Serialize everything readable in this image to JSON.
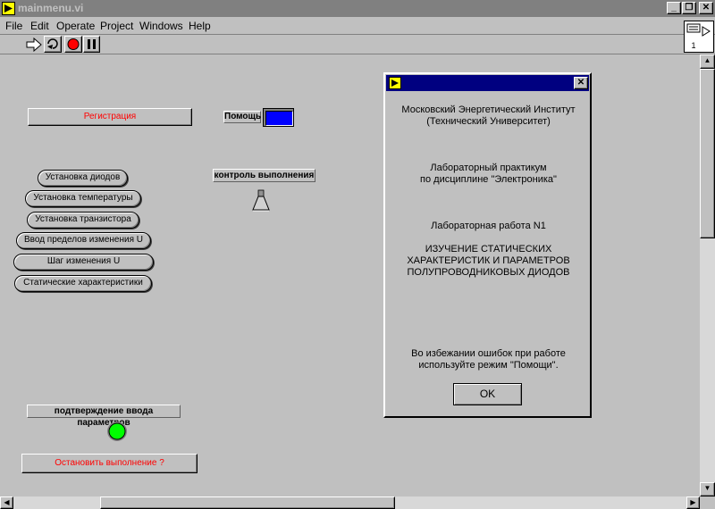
{
  "window": {
    "title": "mainmenu.vi",
    "page_number": "1"
  },
  "menu": [
    "File",
    "Edit",
    "Operate",
    "Project",
    "Windows",
    "Help"
  ],
  "toolbar": {
    "run_icon": "run-arrow-icon",
    "continuous_icon": "continuous-run-icon",
    "abort_icon": "abort-icon",
    "pause_icon": "pause-icon"
  },
  "panel": {
    "registration_button": "Регистрация",
    "help_label": "Помощь",
    "help_indicator_color": "#0000ff",
    "buttons": [
      "Установка диодов",
      "Установка температуры",
      "Установка транзистора",
      "Ввод пределов изменения U",
      "Шаг изменения U",
      "Статические характеристики"
    ],
    "execution_control_label": "контроль выполнения",
    "confirm_label": "подтверждение ввода параметров",
    "confirm_led_color": "#00ff00",
    "stop_button": "Остановить выполнение ?"
  },
  "dialog": {
    "institute_line1": "Московский Энергетический Институт",
    "institute_line2": "(Технический Университет)",
    "practicum_line1": "Лабораторный практикум",
    "practicum_line2": "по дисциплине \"Электроника\"",
    "lab_number": "Лабораторная работа N1",
    "topic_line1": "ИЗУЧЕНИЕ СТАТИЧЕСКИХ",
    "topic_line2": "ХАРАКТЕРИСТИК И ПАРАМЕТРОВ",
    "topic_line3": "ПОЛУПРОВОДНИКОВЫХ ДИОДОВ",
    "hint_line1": "Во избежании ошибок при работе",
    "hint_line2": "используйте режим \"Помощи\".",
    "ok_button": "OK"
  }
}
